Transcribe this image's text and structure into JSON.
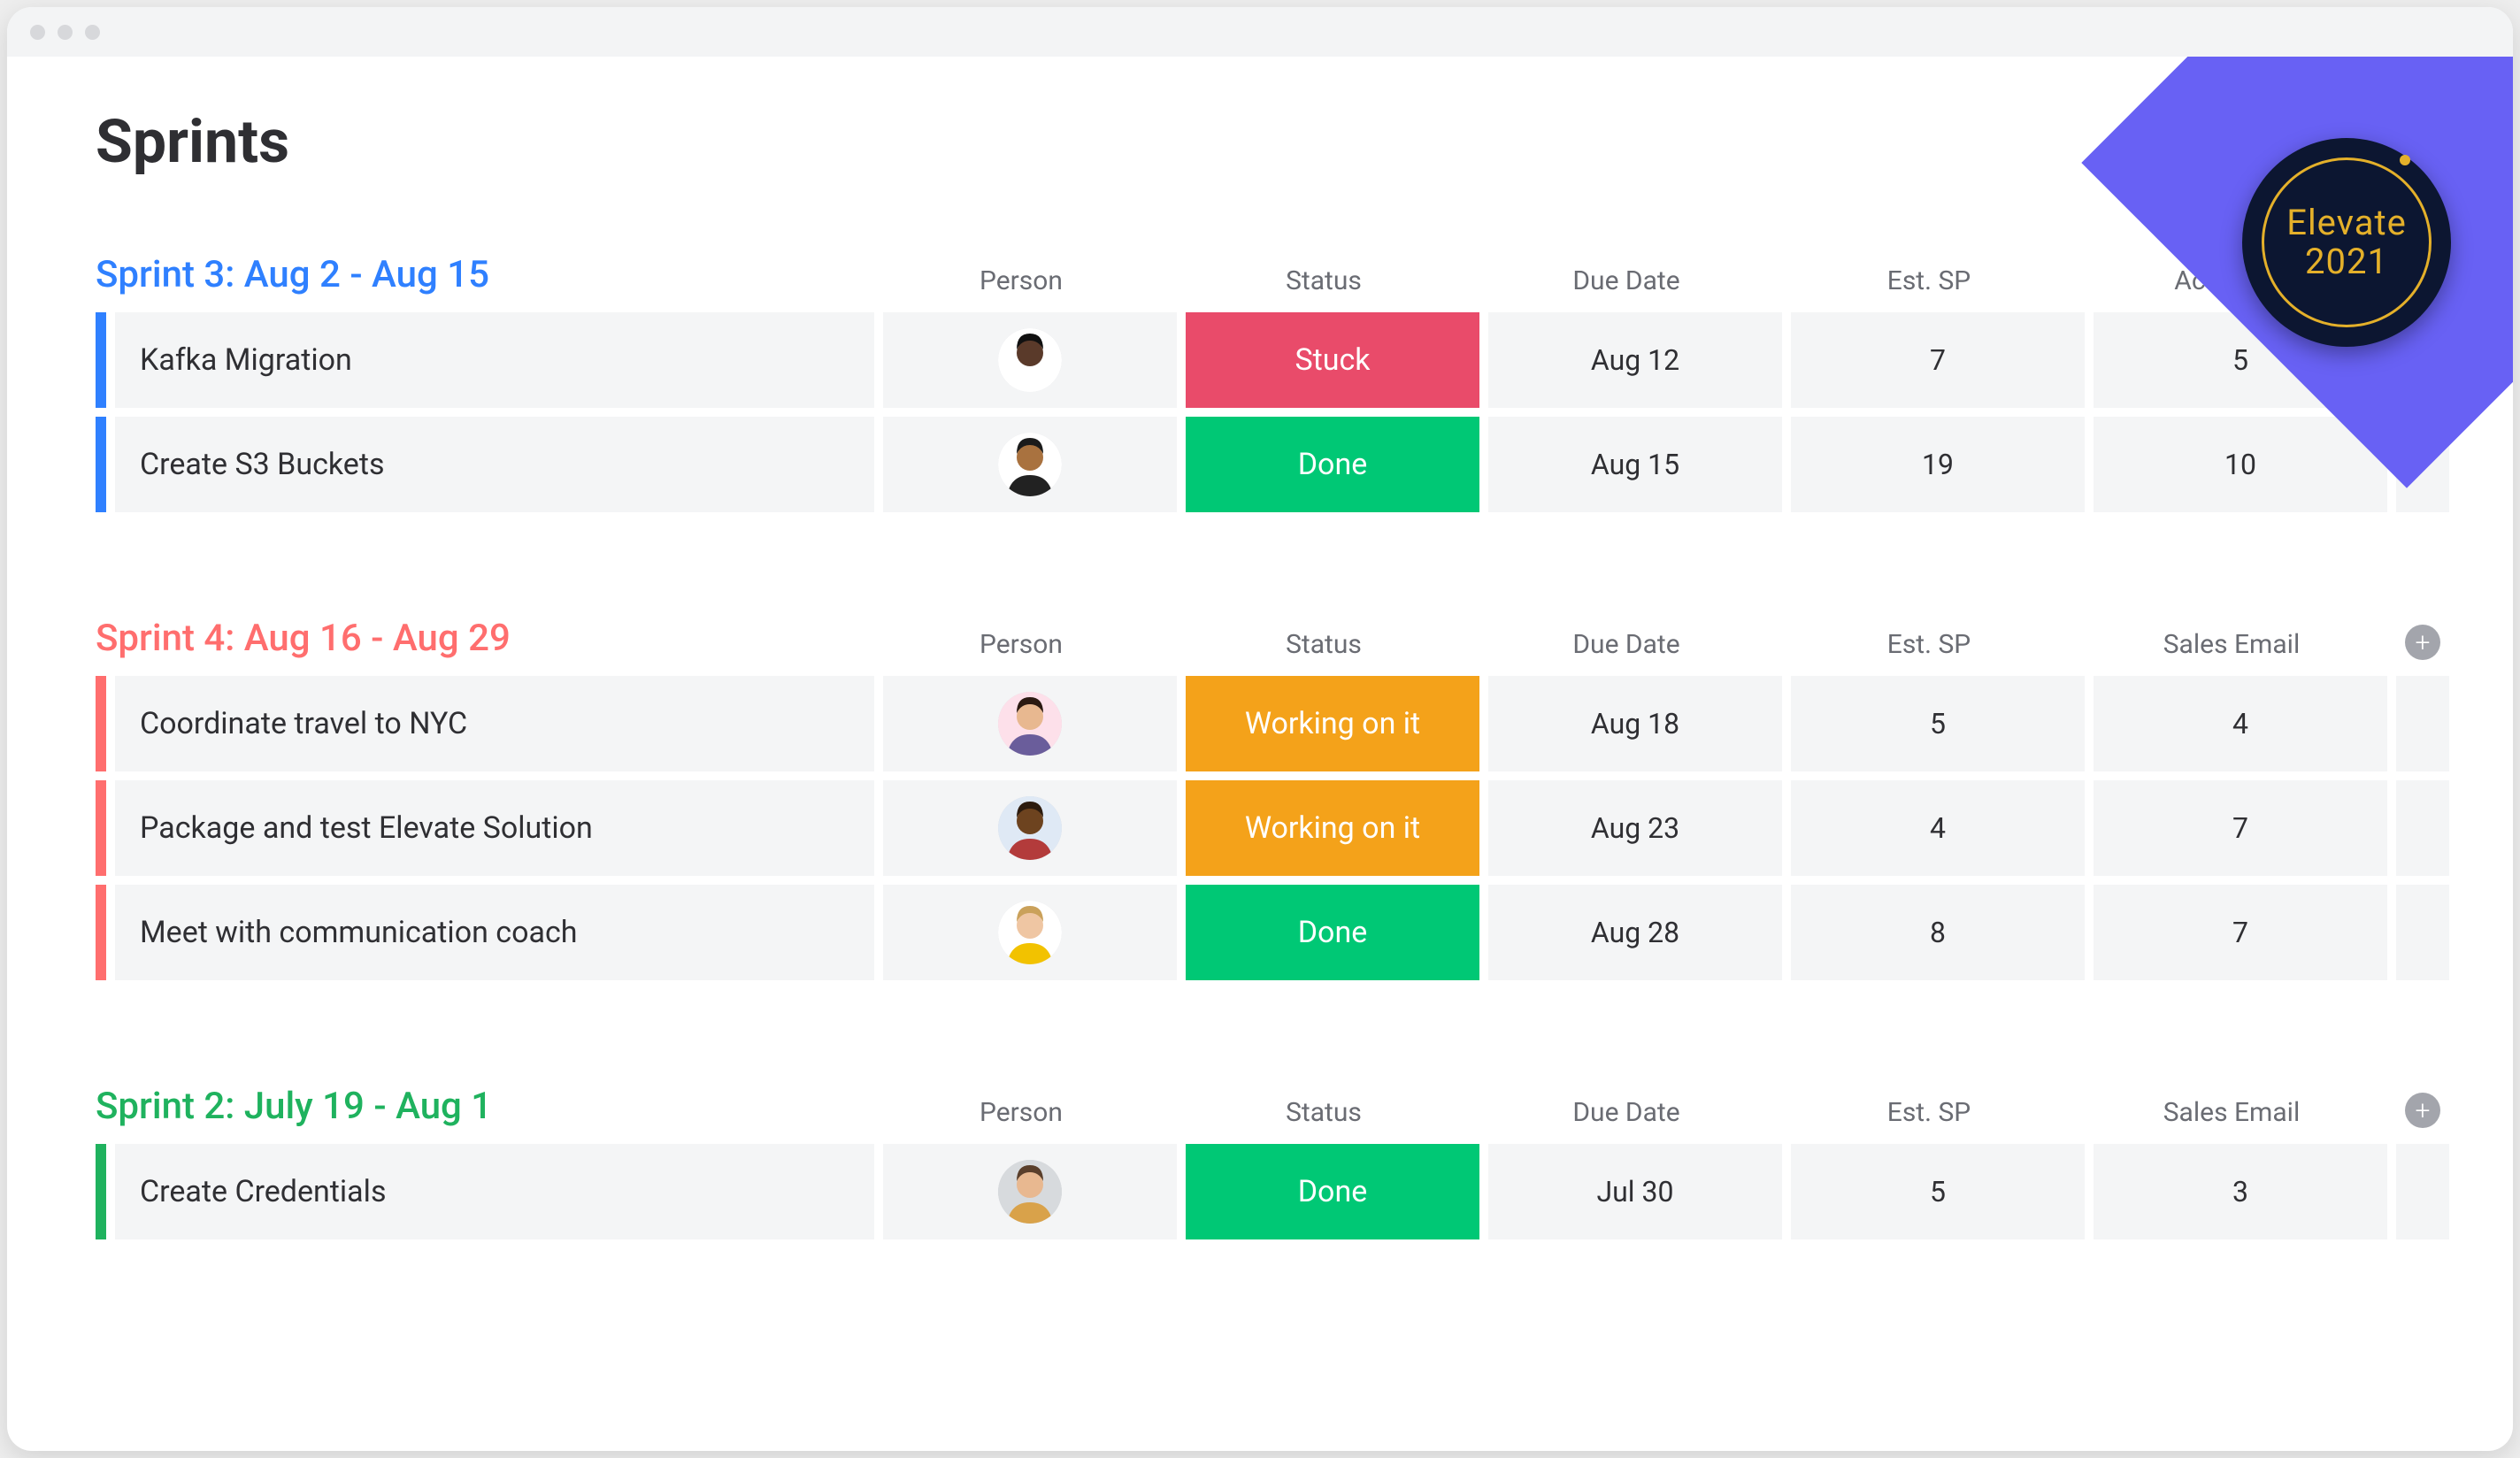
{
  "page_title": "Sprints",
  "badge": {
    "line1": "Elevate",
    "line2": "2021"
  },
  "columns_base": [
    "Person",
    "Status",
    "Due Date",
    "Est. SP"
  ],
  "status_colors": {
    "Stuck": "#e94b6a",
    "Done": "#00c875",
    "Working on it": "#f4a21a"
  },
  "sprints": [
    {
      "title": "Sprint 3: Aug 2 - Aug 15",
      "color": "#2f80ff",
      "last_col": "Actual SP",
      "rows": [
        {
          "task": "Kafka Migration",
          "person": "p1",
          "status": "Stuck",
          "due": "Aug 12",
          "est": "7",
          "last": "5"
        },
        {
          "task": "Create S3 Buckets",
          "person": "p2",
          "status": "Done",
          "due": "Aug 15",
          "est": "19",
          "last": "10"
        }
      ]
    },
    {
      "title": "Sprint 4: Aug 16 - Aug 29",
      "color": "#ff6e6e",
      "last_col": "Sales Email",
      "rows": [
        {
          "task": "Coordinate travel to NYC",
          "person": "p3",
          "status": "Working on it",
          "due": "Aug 18",
          "est": "5",
          "last": "4"
        },
        {
          "task": "Package and test Elevate Solution",
          "person": "p4",
          "status": "Working on it",
          "due": "Aug 23",
          "est": "4",
          "last": "7"
        },
        {
          "task": "Meet with communication coach",
          "person": "p5",
          "status": "Done",
          "due": "Aug 28",
          "est": "8",
          "last": "7"
        }
      ]
    },
    {
      "title": "Sprint 2: July 19 - Aug 1",
      "color": "#1fb25e",
      "last_col": "Sales Email",
      "rows": [
        {
          "task": "Create Credentials",
          "person": "p6",
          "status": "Done",
          "due": "Jul 30",
          "est": "5",
          "last": "3"
        }
      ]
    }
  ],
  "avatars": {
    "p1": {
      "bg": "#ffffff",
      "skin": "#5a3a2a",
      "hair": "#111111",
      "shirt": "#ffffff"
    },
    "p2": {
      "bg": "#ffffff",
      "skin": "#a9723f",
      "hair": "#1b1b1b",
      "shirt": "#222222"
    },
    "p3": {
      "bg": "#fde0ea",
      "skin": "#e8b890",
      "hair": "#2b1a12",
      "shirt": "#6a5d9b"
    },
    "p4": {
      "bg": "#dfe9f5",
      "skin": "#6d431f",
      "hair": "#2d1c0f",
      "shirt": "#b33b3b"
    },
    "p5": {
      "bg": "#ffffff",
      "skin": "#efc6a3",
      "hair": "#caa15a",
      "shirt": "#f2c200"
    },
    "p6": {
      "bg": "#d7dadd",
      "skin": "#e8b890",
      "hair": "#5a3f2b",
      "shirt": "#d9a24a"
    }
  }
}
